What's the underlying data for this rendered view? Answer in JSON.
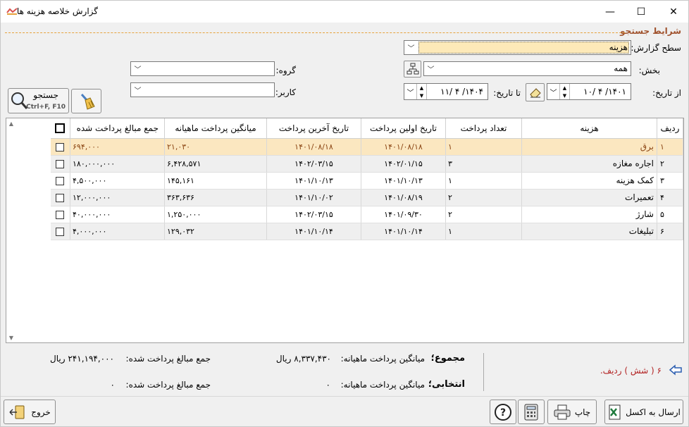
{
  "window": {
    "title": "گزارش خلاصه هزینه ها",
    "minimize": "—",
    "maximize": "☐",
    "close": "✕"
  },
  "search": {
    "section_title": "شرایط جستجو",
    "report_level_label": "سطح گزارش:",
    "report_level_value": "هزینه",
    "section_label": "بخش:",
    "section_value": "همه",
    "group_label": "گروه:",
    "group_value": "",
    "user_label": "کاربر:",
    "user_value": "",
    "from_date_label": "از تاریخ:",
    "from_date_value": "۱۴۰۱/ ۴ /۱۰",
    "to_date_label": "تا تاریخ:",
    "to_date_value": "۱۴۰۴/ ۴ /۱۱",
    "search_button": "جستجو",
    "search_shortcut": "Ctrl+F, F10"
  },
  "table": {
    "headers": [
      "ردیف",
      "هزینه",
      "تعداد پرداخت",
      "تاریخ اولین پرداخت",
      "تاریخ آخرین پرداخت",
      "میانگین پرداخت ماهیانه",
      "جمع مبالغ پرداخت شده"
    ],
    "rows": [
      {
        "row": "۱",
        "name": "برق",
        "count": "۱",
        "first": "۱۴۰۱/۰۸/۱۸",
        "last": "۱۴۰۱/۰۸/۱۸",
        "avg": "۲۱,۰۳۰",
        "sum": "۶۹۴,۰۰۰"
      },
      {
        "row": "۲",
        "name": "اجاره مغازه",
        "count": "۳",
        "first": "۱۴۰۲/۰۱/۱۵",
        "last": "۱۴۰۲/۰۳/۱۵",
        "avg": "۶,۴۲۸,۵۷۱",
        "sum": "۱۸۰,۰۰۰,۰۰۰"
      },
      {
        "row": "۳",
        "name": "کمک هزینه",
        "count": "۱",
        "first": "۱۴۰۱/۱۰/۱۳",
        "last": "۱۴۰۱/۱۰/۱۳",
        "avg": "۱۴۵,۱۶۱",
        "sum": "۴,۵۰۰,۰۰۰"
      },
      {
        "row": "۴",
        "name": "تعمیرات",
        "count": "۲",
        "first": "۱۴۰۱/۰۸/۱۹",
        "last": "۱۴۰۱/۱۰/۰۲",
        "avg": "۳۶۳,۶۳۶",
        "sum": "۱۲,۰۰۰,۰۰۰"
      },
      {
        "row": "۵",
        "name": "شارژ",
        "count": "۲",
        "first": "۱۴۰۱/۰۹/۳۰",
        "last": "۱۴۰۲/۰۳/۱۵",
        "avg": "۱,۲۵۰,۰۰۰",
        "sum": "۴۰,۰۰۰,۰۰۰"
      },
      {
        "row": "۶",
        "name": "تبلیغات",
        "count": "۱",
        "first": "۱۴۰۱/۱۰/۱۴",
        "last": "۱۴۰۱/۱۰/۱۴",
        "avg": "۱۲۹,۰۳۲",
        "sum": "۴,۰۰۰,۰۰۰"
      }
    ]
  },
  "summary": {
    "total_title": "مجموع؛",
    "selected_title": "انتخابی؛",
    "avg_label": "میانگین پرداخت ماهیانه:",
    "sum_label": "جمع مبالغ پرداخت شده:",
    "total_avg": "۸,۳۳۷,۴۳۰ ریال",
    "total_sum": "۲۴۱,۱۹۴,۰۰۰ ریال",
    "selected_avg": "۰",
    "selected_sum": "۰",
    "row_count": "۶ ( شش ) ردیف."
  },
  "buttons": {
    "excel": "ارسال به اکسل",
    "print": "چاپ",
    "exit": "خروج"
  }
}
